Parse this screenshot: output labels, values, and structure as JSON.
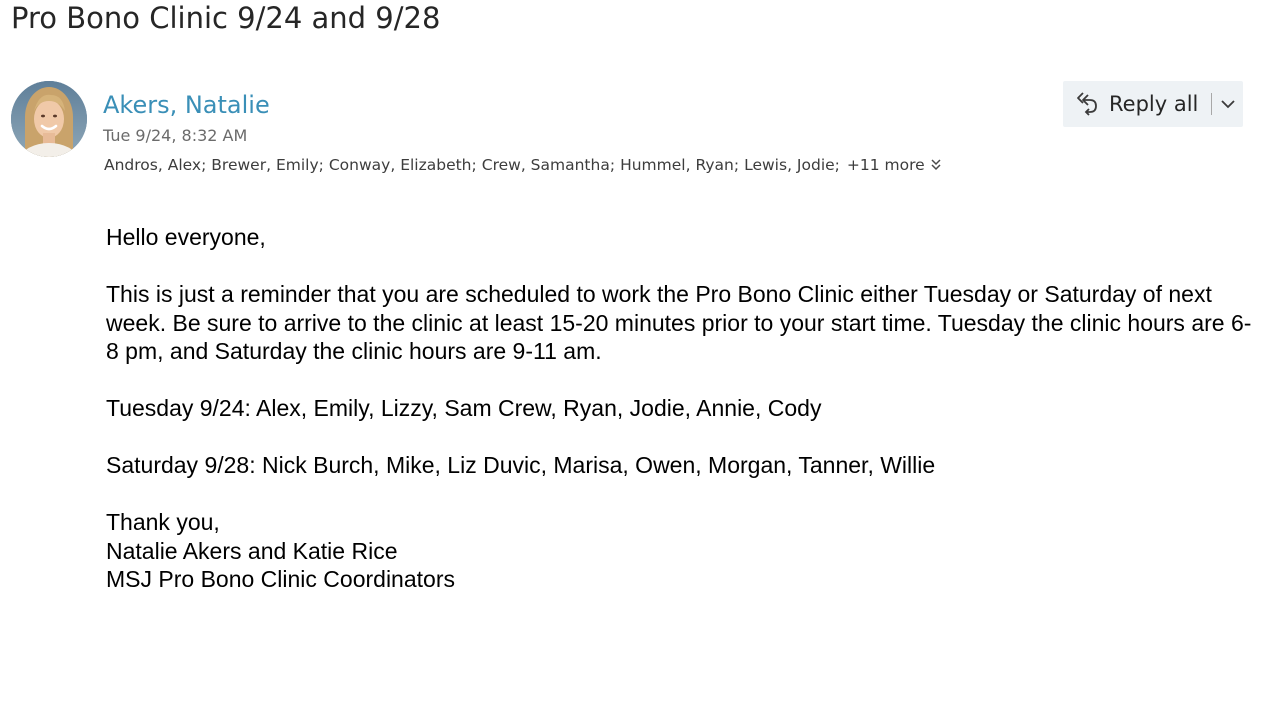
{
  "email": {
    "subject": "Pro Bono Clinic 9/24 and 9/28",
    "sender": "Akers, Natalie",
    "date": "Tue 9/24, 8:32 AM",
    "recipients": [
      "Andros, Alex",
      "Brewer, Emily",
      "Conway, Elizabeth",
      "Crew, Samantha",
      "Hummel, Ryan",
      "Lewis, Jodie"
    ],
    "separator": ";",
    "more_label": "+11 more",
    "body": {
      "greeting": "Hello everyone,",
      "paragraph": "This is just a reminder that you are scheduled to work the Pro Bono Clinic either Tuesday or Saturday of next week. Be sure to arrive to the clinic at least 15-20 minutes prior to your start time. Tuesday the clinic hours are 6-8 pm, and Saturday the clinic hours are 9-11 am.",
      "tuesday": "Tuesday 9/24: Alex, Emily, Lizzy, Sam Crew, Ryan, Jodie, Annie, Cody",
      "saturday": "Saturday 9/28: Nick Burch, Mike, Liz Duvic, Marisa, Owen, Morgan, Tanner, Willie",
      "closing": "Thank you,",
      "signature_names": "Natalie Akers and Katie Rice",
      "signature_title": "MSJ Pro Bono Clinic Coordinators"
    }
  },
  "toolbar": {
    "reply_all_label": "Reply all"
  },
  "icons": {
    "reply_all": "reply-all-icon",
    "dropdown": "chevron-down-icon",
    "expand_recipients": "double-chevron-down-icon"
  },
  "colors": {
    "sender_link": "#3a8fb7",
    "reply_box_bg": "#eef2f5"
  }
}
